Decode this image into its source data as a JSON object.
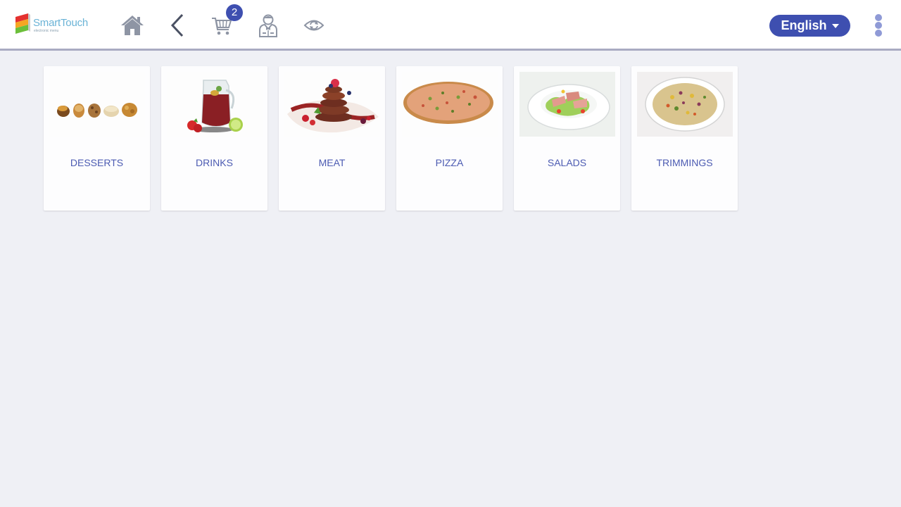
{
  "brand": {
    "name": "SmartTouch",
    "tagline": "electronic menu"
  },
  "cart": {
    "count": "2"
  },
  "language": {
    "selected": "English"
  },
  "categories": [
    {
      "label": "DESSERTS",
      "image": "desserts-photo"
    },
    {
      "label": "DRINKS",
      "image": "drinks-photo"
    },
    {
      "label": "MEAT",
      "image": "meat-photo"
    },
    {
      "label": "PIZZA",
      "image": "pizza-photo"
    },
    {
      "label": "SALADS",
      "image": "salads-photo"
    },
    {
      "label": "TRIMMINGS",
      "image": "trimmings-photo"
    }
  ],
  "colors": {
    "accent": "#3e4fb0",
    "label": "#4c5bb2",
    "icon": "#8e95a4",
    "background": "#eff0f5"
  }
}
